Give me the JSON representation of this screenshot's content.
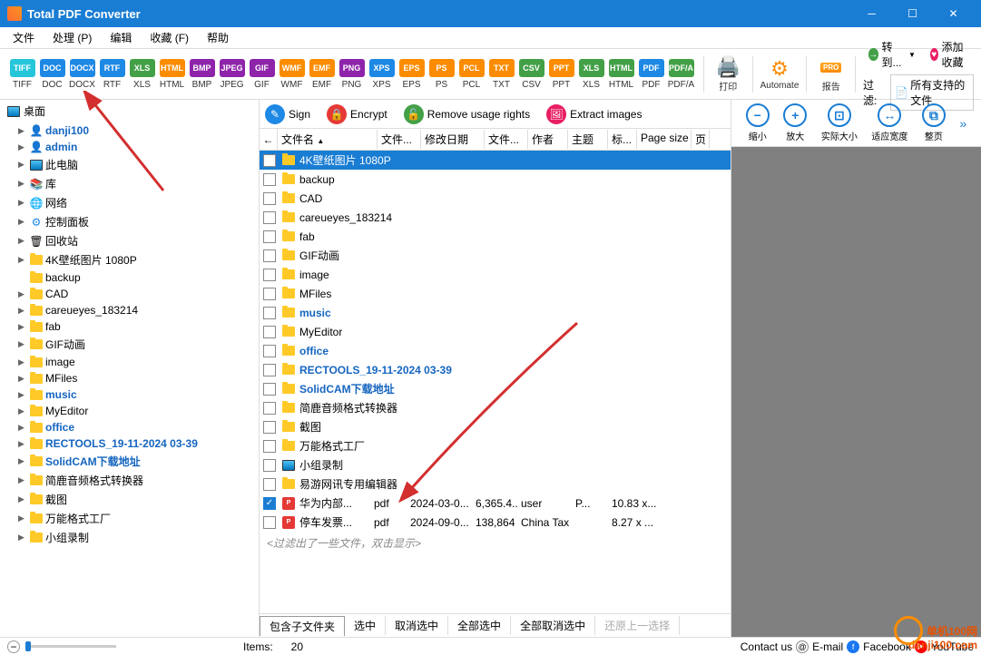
{
  "title": "Total PDF Converter",
  "menu": [
    "文件",
    "处理 (P)",
    "编辑",
    "收藏 (F)",
    "帮助"
  ],
  "formats": [
    {
      "label": "TIFF",
      "color": "#26c6da"
    },
    {
      "label": "DOC",
      "color": "#1e88e5"
    },
    {
      "label": "DOCX",
      "color": "#1e88e5"
    },
    {
      "label": "RTF",
      "color": "#1e88e5"
    },
    {
      "label": "XLS",
      "color": "#43a047"
    },
    {
      "label": "HTML",
      "color": "#fb8c00"
    },
    {
      "label": "BMP",
      "color": "#8e24aa"
    },
    {
      "label": "JPEG",
      "color": "#8e24aa"
    },
    {
      "label": "GIF",
      "color": "#8e24aa"
    },
    {
      "label": "WMF",
      "color": "#fb8c00"
    },
    {
      "label": "EMF",
      "color": "#fb8c00"
    },
    {
      "label": "PNG",
      "color": "#8e24aa"
    },
    {
      "label": "XPS",
      "color": "#1e88e5"
    },
    {
      "label": "EPS",
      "color": "#fb8c00"
    },
    {
      "label": "PS",
      "color": "#fb8c00"
    },
    {
      "label": "PCL",
      "color": "#fb8c00"
    },
    {
      "label": "TXT",
      "color": "#fb8c00"
    },
    {
      "label": "CSV",
      "color": "#43a047"
    },
    {
      "label": "PPT",
      "color": "#fb8c00"
    },
    {
      "label": "XLS",
      "color": "#43a047"
    },
    {
      "label": "HTML",
      "color": "#43a047"
    },
    {
      "label": "PDF",
      "color": "#1e88e5"
    },
    {
      "label": "PDF/A",
      "color": "#43a047"
    }
  ],
  "toolbtns": {
    "print": "打印",
    "automate": "Automate",
    "report": "报告",
    "filter": "过滤:"
  },
  "rightbtns": {
    "goto": "转到...",
    "fav": "添加收藏",
    "filtersel": "所有支持的文件"
  },
  "tree": {
    "root": "桌面",
    "items": [
      {
        "icon": "user",
        "label": "danji100",
        "blue": true
      },
      {
        "icon": "user",
        "label": "admin",
        "blue": true
      },
      {
        "icon": "pc",
        "label": "此电脑",
        "blue": false
      },
      {
        "icon": "lib",
        "label": "库",
        "blue": false
      },
      {
        "icon": "net",
        "label": "网络",
        "blue": false
      },
      {
        "icon": "cp",
        "label": "控制面板",
        "blue": false
      },
      {
        "icon": "bin",
        "label": "回收站",
        "blue": false
      },
      {
        "icon": "folder",
        "label": "4K壁纸图片 1080P",
        "blue": false
      },
      {
        "icon": "folder",
        "label": "backup",
        "blue": false,
        "noexpand": true
      },
      {
        "icon": "folder",
        "label": "CAD",
        "blue": false
      },
      {
        "icon": "folder",
        "label": "careueyes_183214",
        "blue": false
      },
      {
        "icon": "folder",
        "label": "fab",
        "blue": false
      },
      {
        "icon": "folder",
        "label": "GIF动画",
        "blue": false
      },
      {
        "icon": "folder",
        "label": "image",
        "blue": false
      },
      {
        "icon": "folder",
        "label": "MFiles",
        "blue": false
      },
      {
        "icon": "folder",
        "label": "music",
        "blue": true
      },
      {
        "icon": "folder",
        "label": "MyEditor",
        "blue": false
      },
      {
        "icon": "folder",
        "label": "office",
        "blue": true
      },
      {
        "icon": "folder",
        "label": "RECTOOLS_19-11-2024 03-39",
        "blue": true
      },
      {
        "icon": "folder",
        "label": "SolidCAM下载地址",
        "blue": true
      },
      {
        "icon": "folder",
        "label": "简鹿音频格式转换器",
        "blue": false
      },
      {
        "icon": "folder",
        "label": "截图",
        "blue": false
      },
      {
        "icon": "folder",
        "label": "万能格式工厂",
        "blue": false
      },
      {
        "icon": "folder",
        "label": "小组录制",
        "blue": false
      }
    ]
  },
  "actions": {
    "sign": "Sign",
    "encrypt": "Encrypt",
    "remove": "Remove usage rights",
    "extract": "Extract images"
  },
  "columns": [
    "文件名",
    "文件...",
    "修改日期",
    "文件...",
    "作者",
    "主题",
    "标...",
    "Page size",
    "页"
  ],
  "files": [
    {
      "type": "folder",
      "name": "4K壁纸图片 1080P",
      "sel": true
    },
    {
      "type": "folder",
      "name": "backup"
    },
    {
      "type": "folder",
      "name": "CAD"
    },
    {
      "type": "folder",
      "name": "careueyes_183214"
    },
    {
      "type": "folder",
      "name": "fab"
    },
    {
      "type": "folder",
      "name": "GIF动画"
    },
    {
      "type": "folder",
      "name": "image"
    },
    {
      "type": "folder",
      "name": "MFiles"
    },
    {
      "type": "folder",
      "name": "music",
      "blue": true
    },
    {
      "type": "folder",
      "name": "MyEditor"
    },
    {
      "type": "folder",
      "name": "office",
      "blue": true
    },
    {
      "type": "folder",
      "name": "RECTOOLS_19-11-2024 03-39",
      "blue": true
    },
    {
      "type": "folder",
      "name": "SolidCAM下载地址",
      "blue": true
    },
    {
      "type": "folder",
      "name": "简鹿音频格式转换器"
    },
    {
      "type": "folder",
      "name": "截图"
    },
    {
      "type": "folder",
      "name": "万能格式工厂"
    },
    {
      "type": "mon",
      "name": "小组录制"
    },
    {
      "type": "folder",
      "name": "易游网讯专用编辑器"
    },
    {
      "type": "pdf",
      "name": "华为内部...",
      "ext": "pdf",
      "date": "2024-03-0...",
      "size": "6,365.4...",
      "author": "user",
      "subj": "P...",
      "page": "10.83 x...",
      "checked": true
    },
    {
      "type": "pdf",
      "name": "停车发票...",
      "ext": "pdf",
      "date": "2024-09-0...",
      "size": "138,864",
      "author": "China Tax",
      "subj": "",
      "page": "8.27 x ..."
    }
  ],
  "filtermsg": "<过滤出了一些文件，双击显示>",
  "selbar": [
    "包含子文件夹",
    "选中",
    "取消选中",
    "全部选中",
    "全部取消选中",
    "还原上一选择"
  ],
  "preview": [
    "缩小",
    "放大",
    "实际大小",
    "适应宽度",
    "整页"
  ],
  "status": {
    "items": "Items:",
    "count": "20",
    "contact": "Contact us",
    "email": "E-mail",
    "fb": "Facebook",
    "yt": "YouTube"
  },
  "watermark": "单机100网\ndanji100.com"
}
